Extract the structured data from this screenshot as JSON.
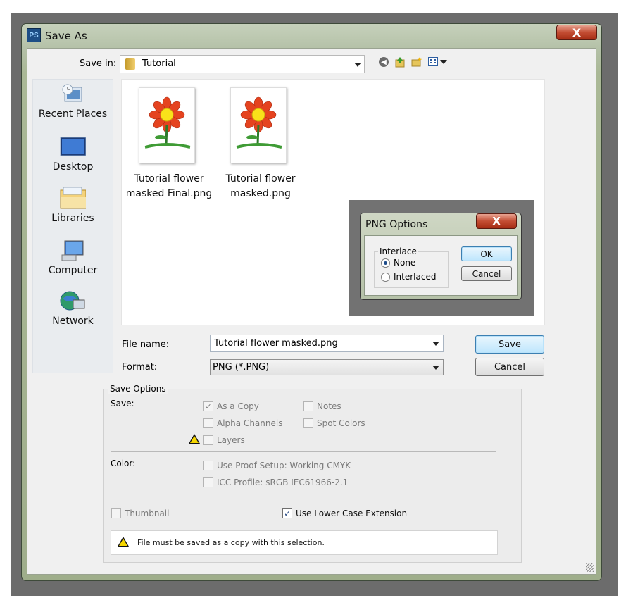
{
  "window": {
    "title": "Save As",
    "app_icon": "PS",
    "close_glyph": "X"
  },
  "save_in": {
    "label": "Save in:",
    "value": "Tutorial"
  },
  "places": [
    {
      "label": "Recent Places",
      "icon": "recent-places-icon"
    },
    {
      "label": "Desktop",
      "icon": "desktop-icon"
    },
    {
      "label": "Libraries",
      "icon": "libraries-icon"
    },
    {
      "label": "Computer",
      "icon": "computer-icon"
    },
    {
      "label": "Network",
      "icon": "network-icon"
    }
  ],
  "files": [
    {
      "line1": "Tutorial flower",
      "line2": "masked Final.png"
    },
    {
      "line1": "Tutorial flower",
      "line2": "masked.png"
    }
  ],
  "png_options": {
    "title": "PNG Options",
    "close_glyph": "X",
    "group_label": "Interlace",
    "options": [
      {
        "label": "None",
        "selected": true
      },
      {
        "label": "Interlaced",
        "selected": false
      }
    ],
    "ok": "OK",
    "cancel": "Cancel"
  },
  "file_name": {
    "label": "File name:",
    "value": "Tutorial flower masked.png"
  },
  "format": {
    "label": "Format:",
    "value": "PNG (*.PNG)"
  },
  "buttons": {
    "save": "Save",
    "cancel": "Cancel"
  },
  "save_options": {
    "title": "Save Options",
    "save_label": "Save:",
    "as_copy": "As a Copy",
    "notes": "Notes",
    "alpha": "Alpha Channels",
    "spot": "Spot Colors",
    "layers": "Layers",
    "color_label": "Color:",
    "proof": "Use Proof Setup:  Working CMYK",
    "icc": "ICC Profile:  sRGB IEC61966-2.1",
    "thumbnail": "Thumbnail",
    "lower_case": "Use Lower Case Extension",
    "warning": "File must be saved as a copy with this selection."
  },
  "colors": {
    "title_bar": "#a9b797",
    "close_red": "#c34d33",
    "accent_blue": "#3c7fb1"
  }
}
